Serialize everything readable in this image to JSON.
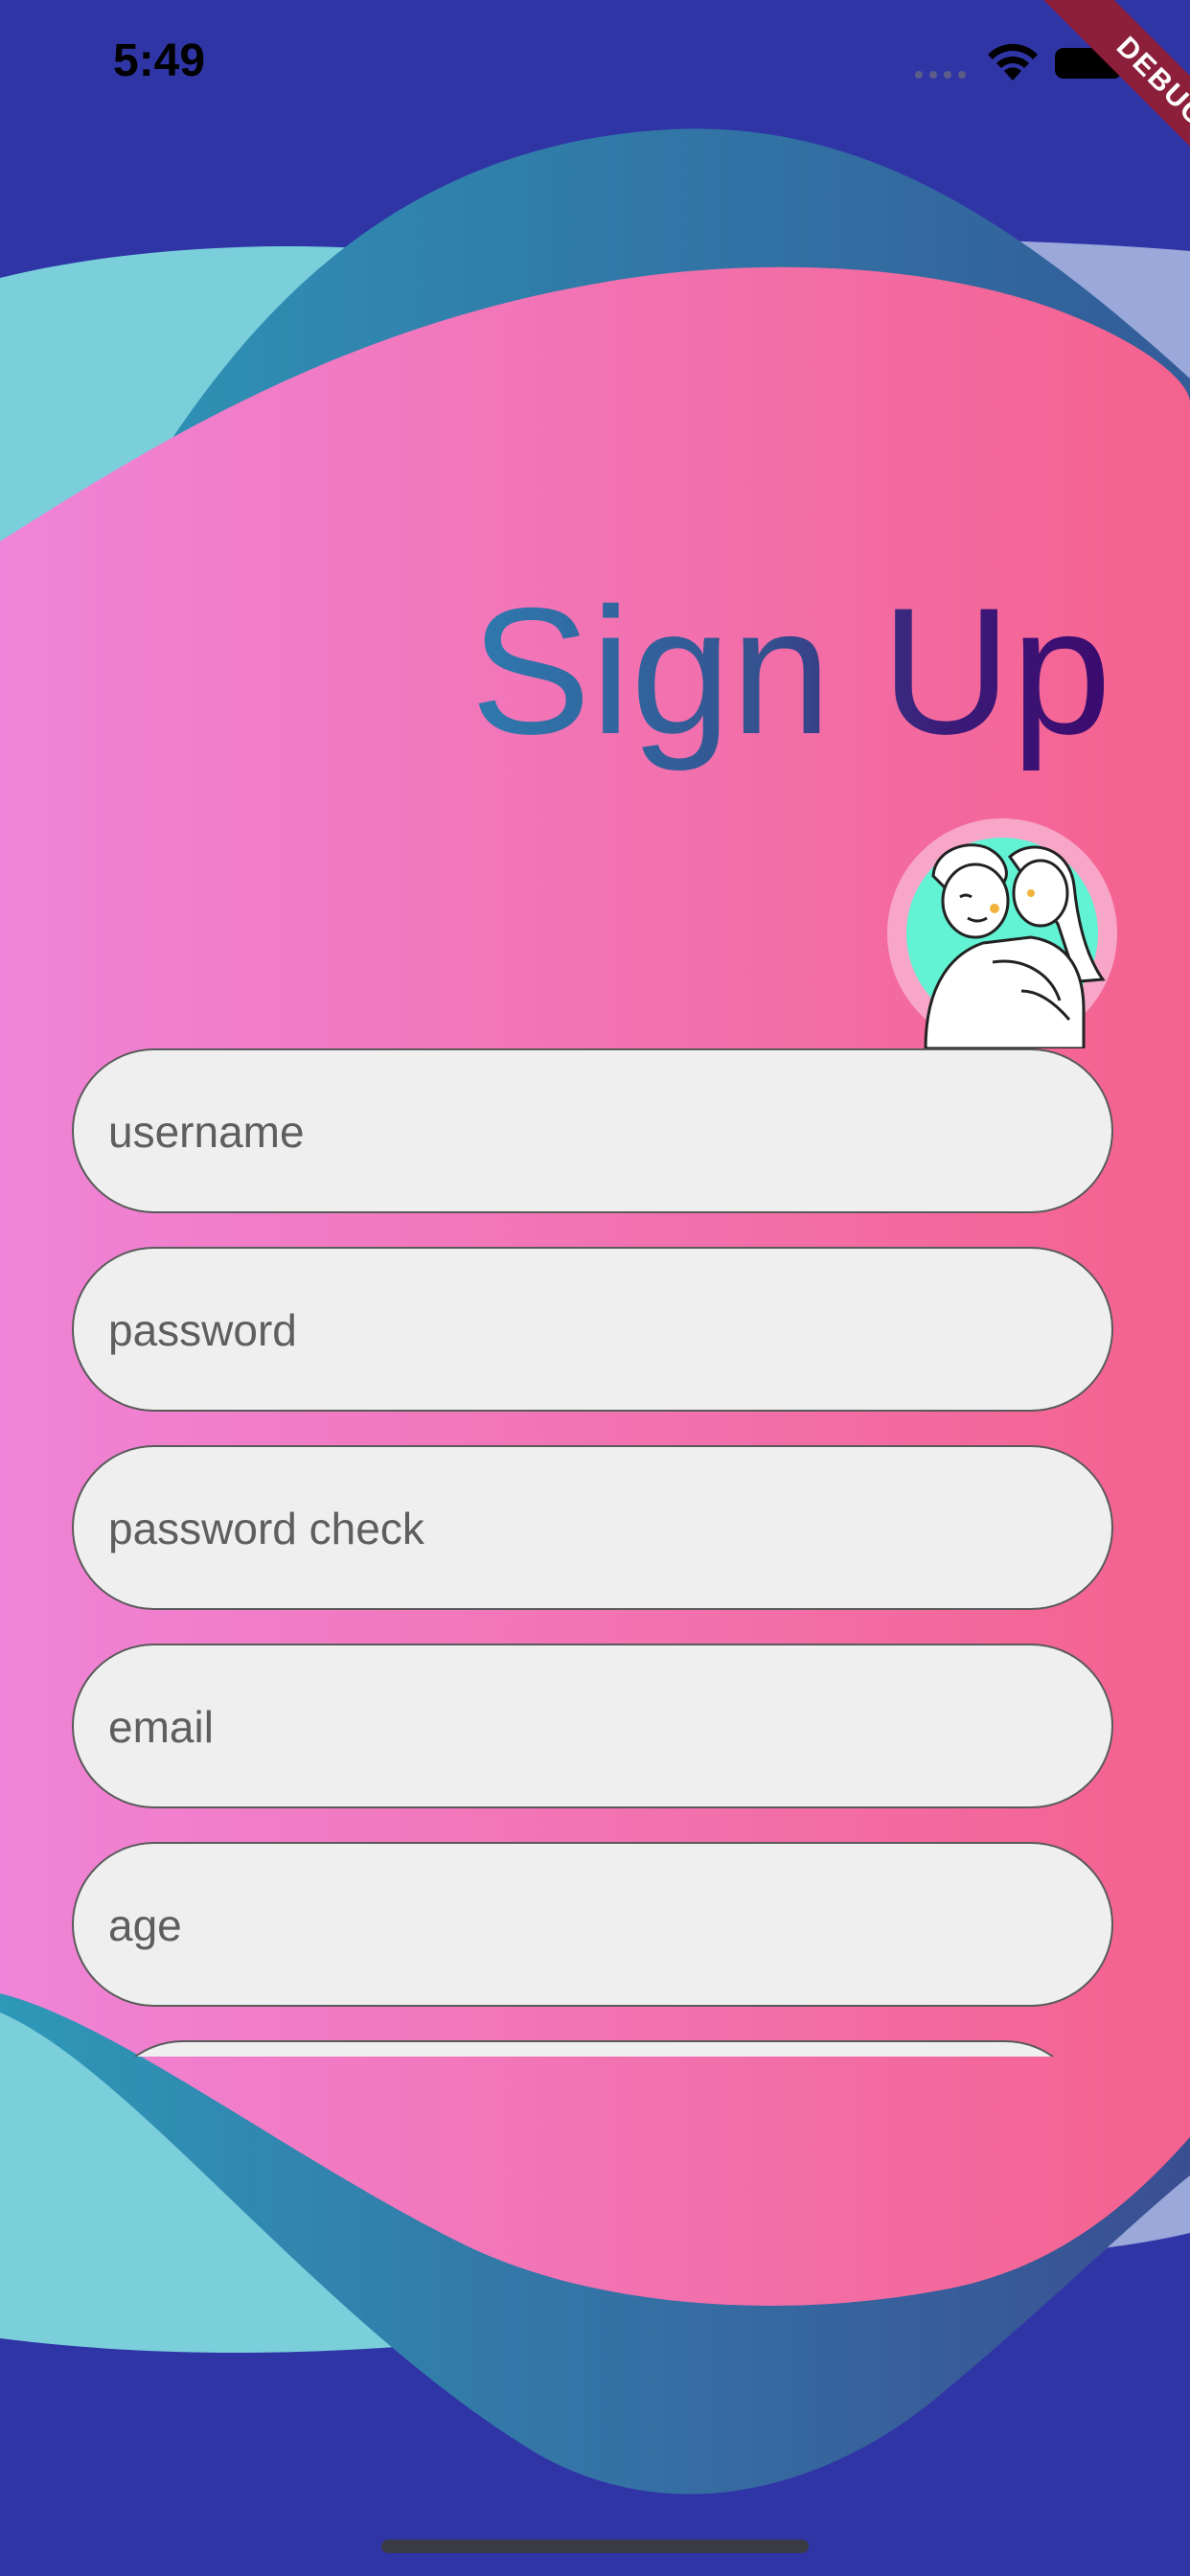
{
  "status_bar": {
    "time": "5:49",
    "icons": [
      "cellular-signal-icon",
      "wifi-icon",
      "battery-icon"
    ]
  },
  "debug_banner": {
    "label": "DEBUG"
  },
  "header": {
    "title": "Sign Up"
  },
  "avatar": {
    "icon": "couple-illustration-icon"
  },
  "form": {
    "fields": [
      {
        "name": "username",
        "placeholder": "username",
        "value": ""
      },
      {
        "name": "password",
        "placeholder": "password",
        "value": ""
      },
      {
        "name": "password_check",
        "placeholder": "password check",
        "value": ""
      },
      {
        "name": "email",
        "placeholder": "email",
        "value": ""
      },
      {
        "name": "age",
        "placeholder": "age",
        "value": ""
      }
    ]
  },
  "colors": {
    "background": "#3035A6",
    "blob_pink_left": "#F084D8",
    "blob_pink_right": "#F4628E",
    "wave_teal": "#2E8FB0",
    "wave_light_teal": "#7ACFDB",
    "field_fill": "#EFEFEF",
    "field_border": "#5A5A5A",
    "avatar_ring": "#F7A6C8",
    "avatar_fill": "#62F2D4",
    "title_gradient_start": "#2E7AAE",
    "title_gradient_end": "#3B0B6E",
    "debug_ribbon": "#8C1F3A"
  }
}
